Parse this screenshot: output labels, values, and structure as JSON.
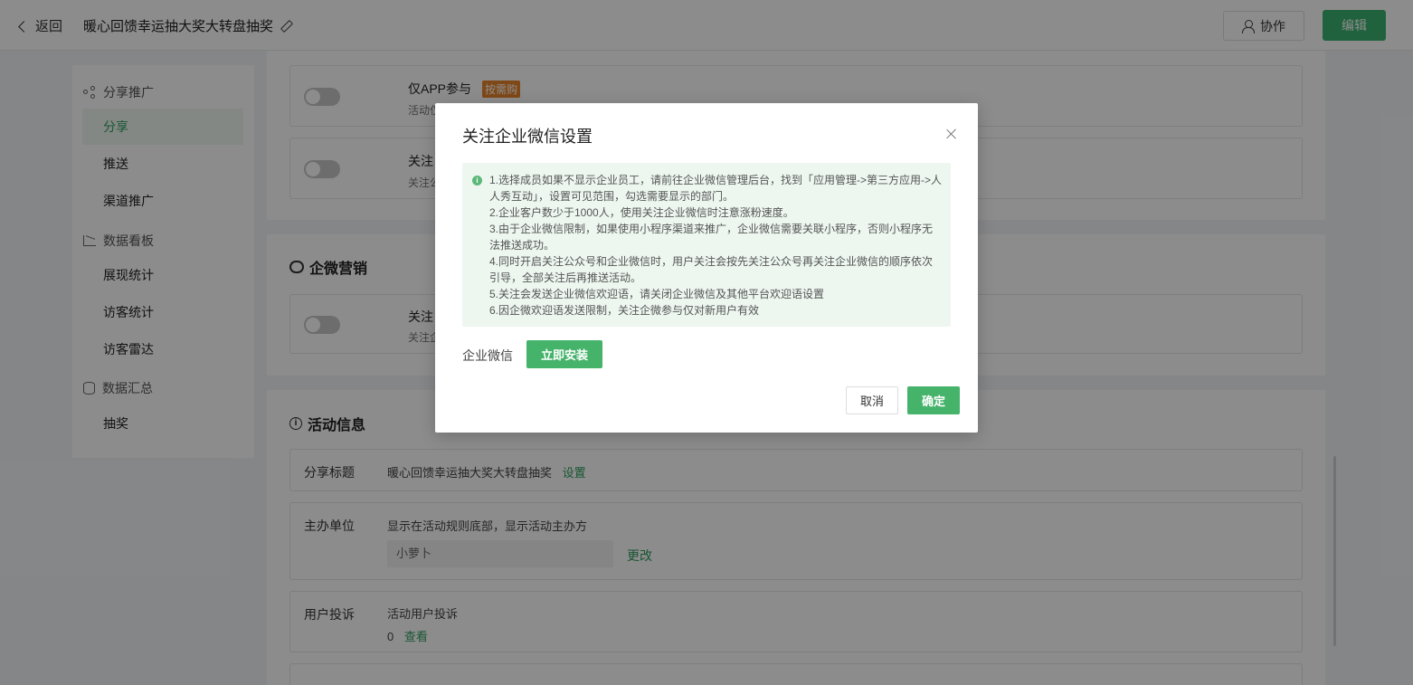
{
  "header": {
    "back_label": "返回",
    "page_title": "暖心回馈幸运抽大奖大转盘抽奖",
    "collab_label": "协作",
    "edit_label": "编辑"
  },
  "sidebar": {
    "groups": [
      {
        "label": "分享推广",
        "icon": "share-icon",
        "items": [
          "分享",
          "推送",
          "渠道推广"
        ]
      },
      {
        "label": "数据看板",
        "icon": "chart-icon",
        "items": [
          "展现统计",
          "访客统计",
          "访客雷达"
        ]
      },
      {
        "label": "数据汇总",
        "icon": "database-icon",
        "items": [
          "抽奖"
        ]
      }
    ],
    "active_item": "分享"
  },
  "main": {
    "app_only": {
      "title": "仅APP参与",
      "tag": "按需购",
      "sub": "活动仅"
    },
    "follow_card": {
      "title": "关注",
      "sub": "关注公"
    },
    "wecom_section": {
      "title": "企微营销",
      "card_title": "关注",
      "card_sub": "关注企"
    },
    "activity_section": {
      "title": "活动信息",
      "share_title": {
        "label": "分享标题",
        "value": "暖心回馈幸运抽大奖大转盘抽奖",
        "link": "设置"
      },
      "organizer": {
        "label": "主办单位",
        "desc": "显示在活动规则底部，显示活动主办方",
        "value": "小萝卜",
        "link": "更改"
      },
      "complaint": {
        "label": "用户投诉",
        "desc": "活动用户投诉",
        "count": "0",
        "link": "查看"
      }
    }
  },
  "modal": {
    "title": "关注企业微信设置",
    "notes": [
      "1.选择成员如果不显示企业员工，请前往企业微信管理后台，找到「应用管理->第三方应用->人",
      "人秀互动」，设置可见范围，勾选需要显示的部门。",
      "2.企业客户数少于1000人，使用关注企业微信时注意涨粉速度。",
      "3.由于企业微信限制，如果使用小程序渠道来推广，企业微信需要关联小程序，否则小程序无",
      "法推送成功。",
      "4.同时开启关注公众号和企业微信时，用户关注会按先关注公众号再关注企业微信的顺序依次",
      "引导，全部关注后再推送活动。",
      "5.关注会发送企业微信欢迎语，请关闭企业微信及其他平台欢迎语设置",
      "6.因企微欢迎语发送限制，关注企微参与仅对新用户有效"
    ],
    "wechat_label": "企业微信",
    "install_label": "立即安装",
    "cancel_label": "取消",
    "ok_label": "确定"
  },
  "colors": {
    "accent": "#46b36b",
    "tag": "#e8842a"
  }
}
